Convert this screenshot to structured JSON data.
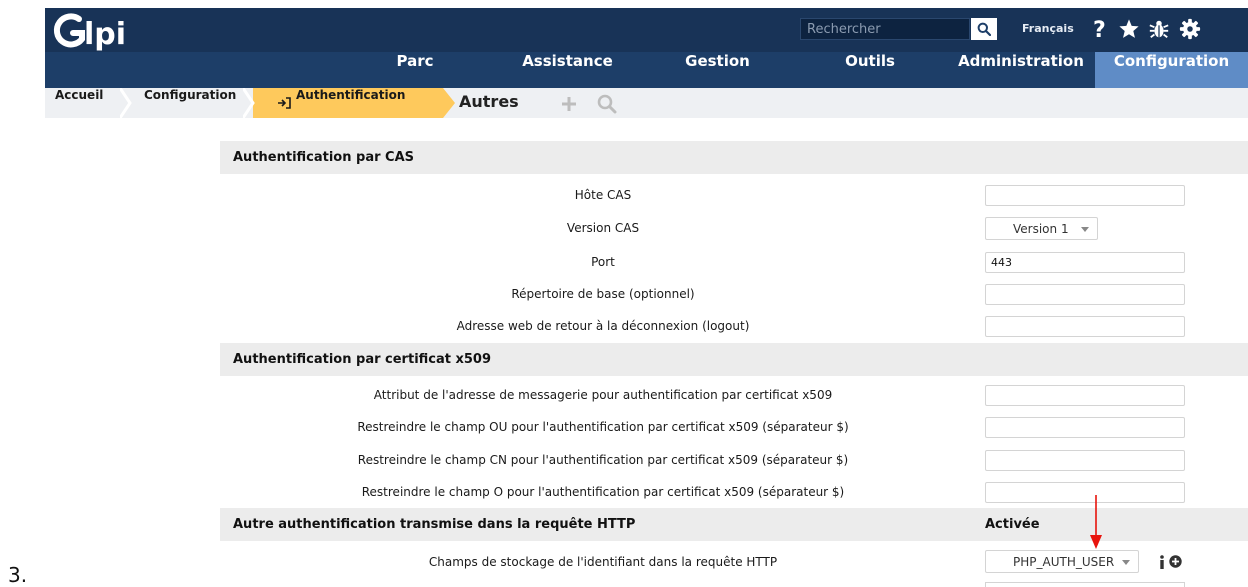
{
  "header": {
    "logo_text": "Glpi",
    "search_placeholder": "Rechercher",
    "language": "Français"
  },
  "menu": [
    "Parc",
    "Assistance",
    "Gestion",
    "Outils",
    "Administration",
    "Configuration"
  ],
  "menu_active": "Configuration",
  "breadcrumb": {
    "home": "Accueil",
    "configuration": "Configuration",
    "current": "Authentification",
    "others": "Autres"
  },
  "sections": {
    "cas": {
      "title": "Authentification par CAS",
      "host_label": "Hôte CAS",
      "host_value": "",
      "version_label": "Version CAS",
      "version_value": "Version 1",
      "port_label": "Port",
      "port_value": "443",
      "base_dir_label": "Répertoire de base (optionnel)",
      "base_dir_value": "",
      "logout_label": "Adresse web de retour à la déconnexion (logout)",
      "logout_value": ""
    },
    "x509": {
      "title": "Authentification par certificat x509",
      "email_label": "Attribut de l'adresse de messagerie pour authentification par certificat x509",
      "ou_label": "Restreindre le champ OU pour l'authentification par certificat x509 (séparateur $)",
      "cn_label": "Restreindre le champ CN pour l'authentification par certificat x509 (séparateur $)",
      "o_label": "Restreindre le champ O pour l'authentification par certificat x509 (séparateur $)"
    },
    "http": {
      "title": "Autre authentification transmise dans la requête HTTP",
      "enabled_label": "Activée",
      "storage_label": "Champs de stockage de l'identifiant dans la requête HTTP",
      "storage_value": "PHP_AUTH_USER"
    }
  },
  "list_number": "3.",
  "colors": {
    "header_bg": "#183357",
    "menu_bg": "#1d3e68",
    "menu_active_bg": "#5f8cc6",
    "breadcrumb_active": "#fec95c",
    "annotation_arrow": "#e8140d"
  }
}
